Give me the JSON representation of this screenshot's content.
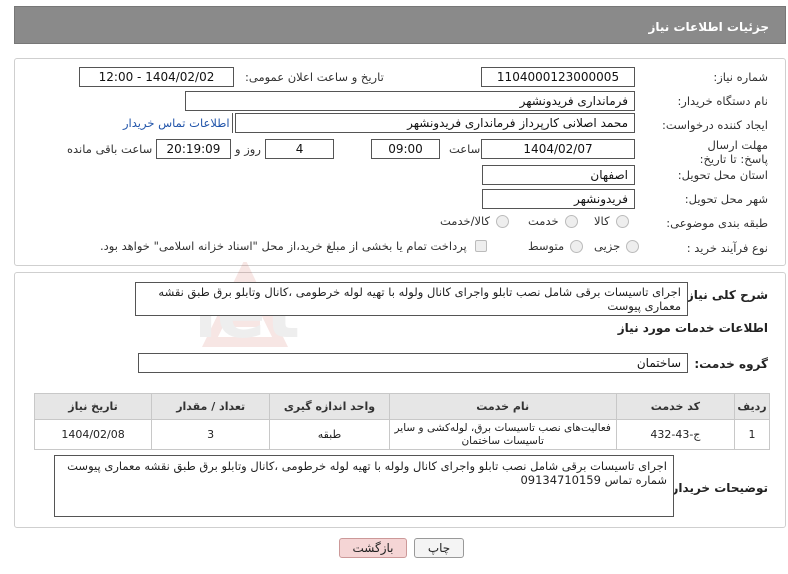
{
  "header": {
    "title": "جزئیات اطلاعات نیاز"
  },
  "fields": {
    "need_number_label": "شماره نیاز:",
    "need_number": "1104000123000005",
    "announce_label": "تاریخ و ساعت اعلان عمومی:",
    "announce_value": "1404/02/02 - 12:00",
    "buyer_org_label": "نام دستگاه خریدار:",
    "buyer_org": "فرمانداری فریدونشهر",
    "creator_label": "ایجاد کننده درخواست:",
    "creator": "محمد اصلانی کارپرداز فرمانداری فریدونشهر",
    "contact_link": "اطلاعات تماس خریدار",
    "deadline_label": "مهلت ارسال پاسخ: تا تاریخ:",
    "deadline_date": "1404/02/07",
    "time_label": "ساعت",
    "deadline_time": "09:00",
    "days_value": "4",
    "days_label": "روز و",
    "remaining_time": "20:19:09",
    "remaining_label": "ساعت باقی مانده",
    "province_label": "استان محل تحویل:",
    "province": "اصفهان",
    "city_label": "شهر محل تحویل:",
    "city": "فریدونشهر",
    "category_label": "طبقه بندی موضوعی:",
    "category_options": [
      "کالا",
      "خدمت",
      "کالا/خدمت"
    ],
    "purchase_type_label": "نوع فرآیند خرید :",
    "purchase_options": [
      "جزیی",
      "متوسط"
    ],
    "payment_note": "پرداخت تمام یا بخشی از مبلغ خرید،از محل \"اسناد خزانه اسلامی\" خواهد بود."
  },
  "details": {
    "summary_label": "شرح کلی نیاز:",
    "summary": "اجرای تاسیسات برقی شامل نصب تابلو واجرای کانال ولوله با تهیه لوله خرطومی ،کانال وتابلو برق طبق نقشه معماری پیوست",
    "services_heading": "اطلاعات خدمات مورد نیاز",
    "service_group_label": "گروه خدمت:",
    "service_group": "ساختمان",
    "table": {
      "headers": [
        "ردیف",
        "کد خدمت",
        "نام خدمت",
        "واحد اندازه گیری",
        "تعداد / مقدار",
        "تاریخ نیاز"
      ],
      "rows": [
        [
          "1",
          "ج-43-432",
          "فعالیت‌های نصب تاسیسات برق، لوله‌کشی و سایر تاسیسات ساختمان",
          "طبقه",
          "3",
          "1404/02/08"
        ]
      ]
    },
    "buyer_notes_label": "توضیحات خریدار:",
    "buyer_notes_line1": "اجرای تاسیسات برقی شامل نصب تابلو واجرای کانال ولوله با تهیه لوله خرطومی ،کانال وتابلو برق طبق نقشه معماری پیوست",
    "buyer_notes_line2": "شماره تماس 09134710159"
  },
  "buttons": {
    "print": "چاپ",
    "back": "بازگشت"
  },
  "watermark": "AriaTender.net",
  "colors": {
    "header_bg": "#8a8a8a",
    "link": "#2255aa",
    "back_btn_bg": "#f5d5d5"
  }
}
